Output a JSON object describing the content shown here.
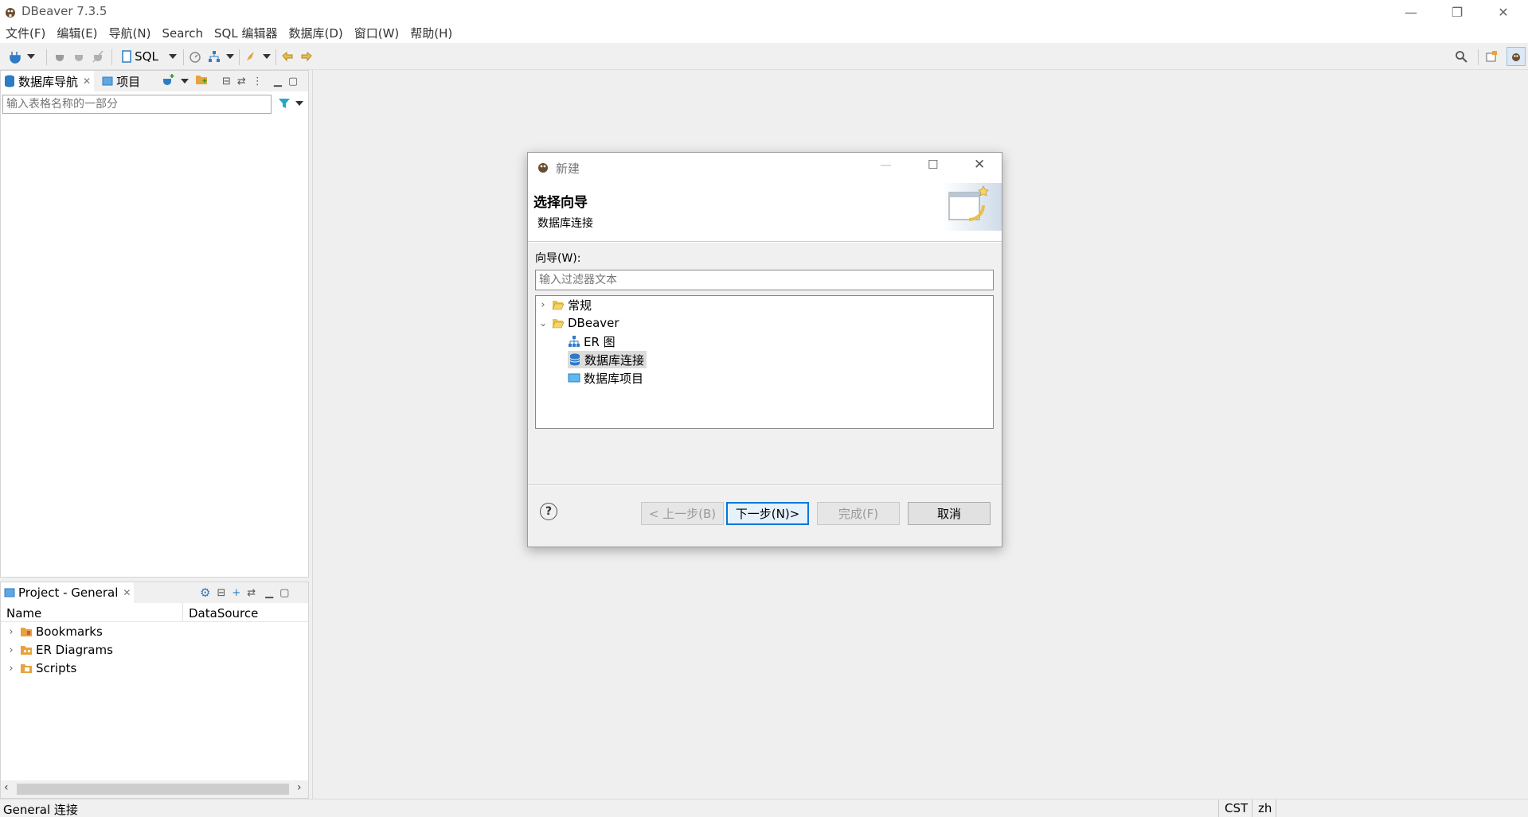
{
  "window": {
    "title": "DBeaver 7.3.5",
    "controls": {
      "minimize": "—",
      "restore": "❐",
      "close": "✕"
    }
  },
  "menu": [
    "文件(F)",
    "编辑(E)",
    "导航(N)",
    "Search",
    "SQL 编辑器",
    "数据库(D)",
    "窗口(W)",
    "帮助(H)"
  ],
  "toolbar": {
    "sql_label": "SQL"
  },
  "navigator": {
    "tabs": [
      {
        "label": "数据库导航",
        "active": true
      },
      {
        "label": "项目",
        "active": false
      }
    ],
    "filter_placeholder": "输入表格名称的一部分"
  },
  "project_panel": {
    "tab_label": "Project - General",
    "columns": [
      "Name",
      "DataSource"
    ],
    "items": [
      "Bookmarks",
      "ER Diagrams",
      "Scripts"
    ]
  },
  "dialog": {
    "title": "新建",
    "heading": "选择向导",
    "subheading": "数据库连接",
    "wizard_label": "向导(W):",
    "filter_placeholder": "输入过滤器文本",
    "tree": {
      "general": "常规",
      "dbeaver": "DBeaver",
      "er_diagram": "ER 图",
      "db_connection": "数据库连接",
      "db_project": "数据库项目"
    },
    "buttons": {
      "back": "< 上一步(B)",
      "next": "下一步(N)>",
      "finish": "完成(F)",
      "cancel": "取消"
    }
  },
  "statusbar": {
    "left": "General 连接",
    "timezone": "CST",
    "locale": "zh"
  },
  "colors": {
    "accent": "#0078d7",
    "folder": "#e8a33a",
    "db_blue": "#2f7bc4",
    "selection": "#dcdcdc"
  }
}
